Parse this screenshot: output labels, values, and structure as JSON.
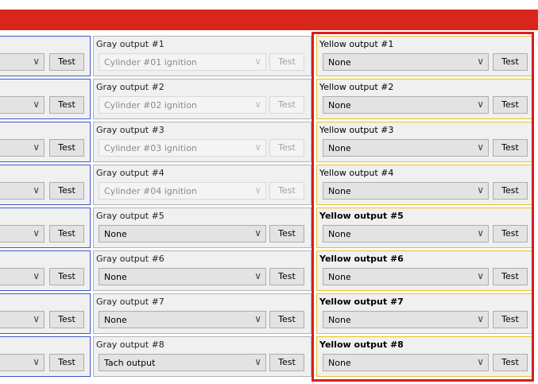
{
  "test_label": "Test",
  "blue_rows": 8,
  "gray_outputs": [
    {
      "label": "Gray output #1",
      "value": "Cylinder #01 ignition",
      "enabled": false
    },
    {
      "label": "Gray output #2",
      "value": "Cylinder #02 ignition",
      "enabled": false
    },
    {
      "label": "Gray output #3",
      "value": "Cylinder #03 ignition",
      "enabled": false
    },
    {
      "label": "Gray output #4",
      "value": "Cylinder #04 ignition",
      "enabled": false
    },
    {
      "label": "Gray output #5",
      "value": "None",
      "enabled": true
    },
    {
      "label": "Gray output #6",
      "value": "None",
      "enabled": true
    },
    {
      "label": "Gray output #7",
      "value": "None",
      "enabled": true
    },
    {
      "label": "Gray output #8",
      "value": "Tach output",
      "enabled": true
    }
  ],
  "yellow_outputs": [
    {
      "label": "Yellow output #1",
      "value": "None"
    },
    {
      "label": "Yellow output #2",
      "value": "None"
    },
    {
      "label": "Yellow output #3",
      "value": "None"
    },
    {
      "label": "Yellow output #4",
      "value": "None"
    },
    {
      "label": "Yellow output #5",
      "value": "None"
    },
    {
      "label": "Yellow output #6",
      "value": "None"
    },
    {
      "label": "Yellow output #7",
      "value": "None"
    },
    {
      "label": "Yellow output #8",
      "value": "None"
    }
  ],
  "colors": {
    "header_bar": "#d9261c",
    "highlight_border": "#d61f1f",
    "blue_group_border": "#3f58c7",
    "gray_group_border": "#b4b4b4",
    "yellow_group_border": "#e6c229"
  },
  "icons": {
    "dropdown": "chevron-down-icon"
  }
}
